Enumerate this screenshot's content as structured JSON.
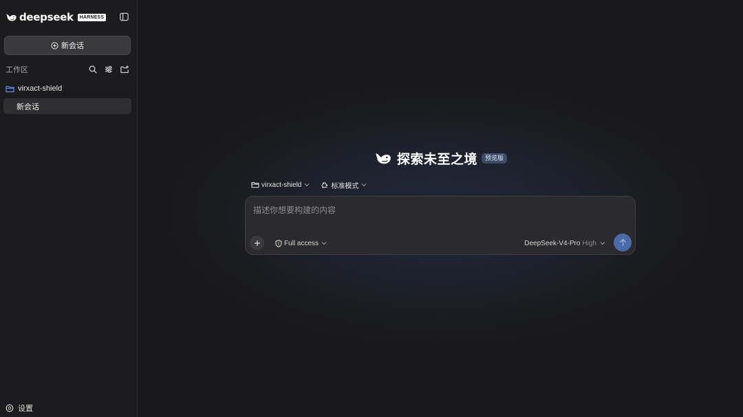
{
  "brand": {
    "name": "deepseek",
    "badge": "HARNESS"
  },
  "sidebar": {
    "new_chat_label": "新会话",
    "workspace_label": "工作区",
    "project_name": "virxact-shield",
    "active_chat_label": "新会话",
    "settings_label": "设置"
  },
  "main": {
    "hero_title": "探索未至之境",
    "hero_badge": "预览版",
    "context": {
      "project_label": "virxact-shield",
      "mode_label": "标准模式"
    },
    "composer": {
      "placeholder": "描述你想要构建的内容",
      "access_label": "Full access",
      "model_name": "DeepSeek-V4-Pro",
      "model_effort": "High"
    }
  },
  "colors": {
    "accent": "#4a6aa8",
    "folder_icon": "#5b8def",
    "sidebar_bg": "#1c1c1e",
    "main_bg": "#1b1c20"
  }
}
